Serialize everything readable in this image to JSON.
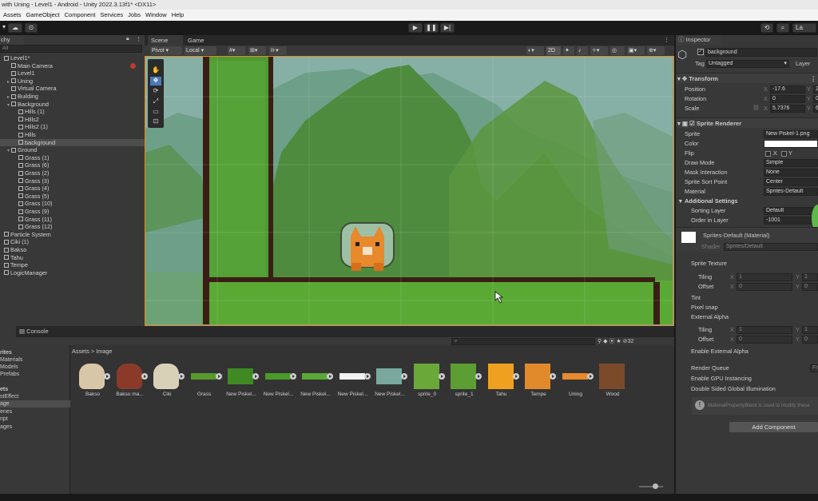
{
  "title": "with Uning - Level1 - Android - Unity 2022.3.13f1* <DX11>",
  "menu": [
    "Assets",
    "GameObject",
    "Component",
    "Services",
    "Jobs",
    "Window",
    "Help"
  ],
  "hierarchy": {
    "tab": "chy",
    "search_placeholder": "All",
    "items": [
      {
        "label": "Level1*",
        "indent": 0,
        "arrow": ""
      },
      {
        "label": "Main Camera",
        "indent": 1,
        "arrow": ""
      },
      {
        "label": "Level1",
        "indent": 1,
        "arrow": ""
      },
      {
        "label": "Uning",
        "indent": 1,
        "arrow": "▸"
      },
      {
        "label": "Virtual Camera",
        "indent": 1,
        "arrow": ""
      },
      {
        "label": "Building",
        "indent": 1,
        "arrow": "▸"
      },
      {
        "label": "Background",
        "indent": 1,
        "arrow": "▾"
      },
      {
        "label": "Hills (1)",
        "indent": 2,
        "arrow": ""
      },
      {
        "label": "Hills2",
        "indent": 2,
        "arrow": ""
      },
      {
        "label": "Hills2 (1)",
        "indent": 2,
        "arrow": ""
      },
      {
        "label": "Hills",
        "indent": 2,
        "arrow": ""
      },
      {
        "label": "background",
        "indent": 2,
        "arrow": "",
        "selected": true
      },
      {
        "label": "Ground",
        "indent": 1,
        "arrow": "▾"
      },
      {
        "label": "Grass (1)",
        "indent": 2,
        "arrow": ""
      },
      {
        "label": "Grass (6)",
        "indent": 2,
        "arrow": ""
      },
      {
        "label": "Grass (2)",
        "indent": 2,
        "arrow": ""
      },
      {
        "label": "Grass (3)",
        "indent": 2,
        "arrow": ""
      },
      {
        "label": "Grass (4)",
        "indent": 2,
        "arrow": ""
      },
      {
        "label": "Grass (5)",
        "indent": 2,
        "arrow": ""
      },
      {
        "label": "Grass (10)",
        "indent": 2,
        "arrow": ""
      },
      {
        "label": "Grass (9)",
        "indent": 2,
        "arrow": ""
      },
      {
        "label": "Grass (11)",
        "indent": 2,
        "arrow": ""
      },
      {
        "label": "Grass (12)",
        "indent": 2,
        "arrow": ""
      },
      {
        "label": "Particle System",
        "indent": 0,
        "arrow": ""
      },
      {
        "label": "Ciki (1)",
        "indent": 0,
        "arrow": ""
      },
      {
        "label": "Bakso",
        "indent": 0,
        "arrow": ""
      },
      {
        "label": "Tahu",
        "indent": 0,
        "arrow": ""
      },
      {
        "label": "Tempe",
        "indent": 0,
        "arrow": ""
      },
      {
        "label": "LogicManager",
        "indent": 0,
        "arrow": ""
      }
    ]
  },
  "scene": {
    "tabs": {
      "scene": "Scene",
      "game": "Game"
    },
    "tools": {
      "pivot": "Pivot",
      "local": "Local",
      "mode_2d": "2D"
    }
  },
  "inspector": {
    "tab": "Inspector",
    "object_name": "background",
    "tag_label": "Tag",
    "tag_value": "Untagged",
    "layer_label": "Layer",
    "transform": {
      "title": "Transform",
      "position_label": "Position",
      "position_x": "-17.6",
      "position_y": "2",
      "rotation_label": "Rotation",
      "rotation_x": "0",
      "rotation_y": "0",
      "scale_label": "Scale",
      "scale_x": "5.7376",
      "scale_y": "6"
    },
    "sprite_renderer": {
      "title": "Sprite Renderer",
      "sprite_label": "Sprite",
      "sprite_value": "New Piskel-1.png",
      "color_label": "Color",
      "flip_label": "Flip",
      "flip_x": "X",
      "flip_y": "Y",
      "draw_mode_label": "Draw Mode",
      "draw_mode_value": "Simple",
      "mask_label": "Mask Interaction",
      "mask_value": "None",
      "sort_point_label": "Sprite Sort Point",
      "sort_point_value": "Center",
      "material_label": "Material",
      "material_value": "Sprites-Default",
      "additional": "Additional Settings",
      "sorting_layer_label": "Sorting Layer",
      "sorting_layer_value": "Default",
      "order_label": "Order in Layer",
      "order_value": "-1001"
    },
    "material": {
      "title": "Sprites-Default (Material)",
      "shader_label": "Shader",
      "shader_value": "Sprites/Default",
      "sprite_texture": "Sprite Texture",
      "tiling": "Tiling",
      "offset": "Offset",
      "tiling_x": "1",
      "tiling_y": "1",
      "offset_x": "0",
      "offset_y": "0",
      "tint": "Tint",
      "pixel_snap": "Pixel snap",
      "external_alpha": "External Alpha",
      "tiling2_x": "1",
      "tiling2_y": "1",
      "offset2_x": "0",
      "offset2_y": "0",
      "enable_external_alpha": "Enable External Alpha",
      "render_queue": "Render Queue",
      "render_queue_value": "Fr",
      "gpu_instancing": "Enable GPU Instancing",
      "double_sided": "Double Sided Global Illumination",
      "info": "MaterialPropertyBlock is used to modify these"
    },
    "add_component": "Add Component"
  },
  "bottom": {
    "console_tab": "Console",
    "breadcrumb": "Assets > Image",
    "count": "32",
    "folders": [
      "rites",
      "Materials",
      "Models",
      "Prefabs",
      "ets",
      "stEffect",
      "age",
      "enes",
      "ript",
      "ages"
    ],
    "assets": [
      {
        "label": "Bakso",
        "color": "#d8c6a8"
      },
      {
        "label": "Bakso ma...",
        "color": "#8b3a2a"
      },
      {
        "label": "Ciki",
        "color": "#d9d0b8"
      },
      {
        "label": "Grass",
        "color": "#5a9a2c"
      },
      {
        "label": "New Piskel...",
        "color": "#3f8a23"
      },
      {
        "label": "New Piskel...",
        "color": "#4a9a2a"
      },
      {
        "label": "New Piskel...",
        "color": "#5aa835"
      },
      {
        "label": "New Piskel...",
        "color": "#f2f2f2"
      },
      {
        "label": "New Piskel...",
        "color": "#7aa89f"
      },
      {
        "label": "sprite_0",
        "color": "#6aa83a"
      },
      {
        "label": "sprite_1",
        "color": "#5c9e33"
      },
      {
        "label": "Tahu",
        "color": "#f0a020"
      },
      {
        "label": "Tempe",
        "color": "#e08a2c"
      },
      {
        "label": "Uning",
        "color": "#e8892c"
      },
      {
        "label": "Wood",
        "color": "#7a4a2a"
      }
    ]
  }
}
